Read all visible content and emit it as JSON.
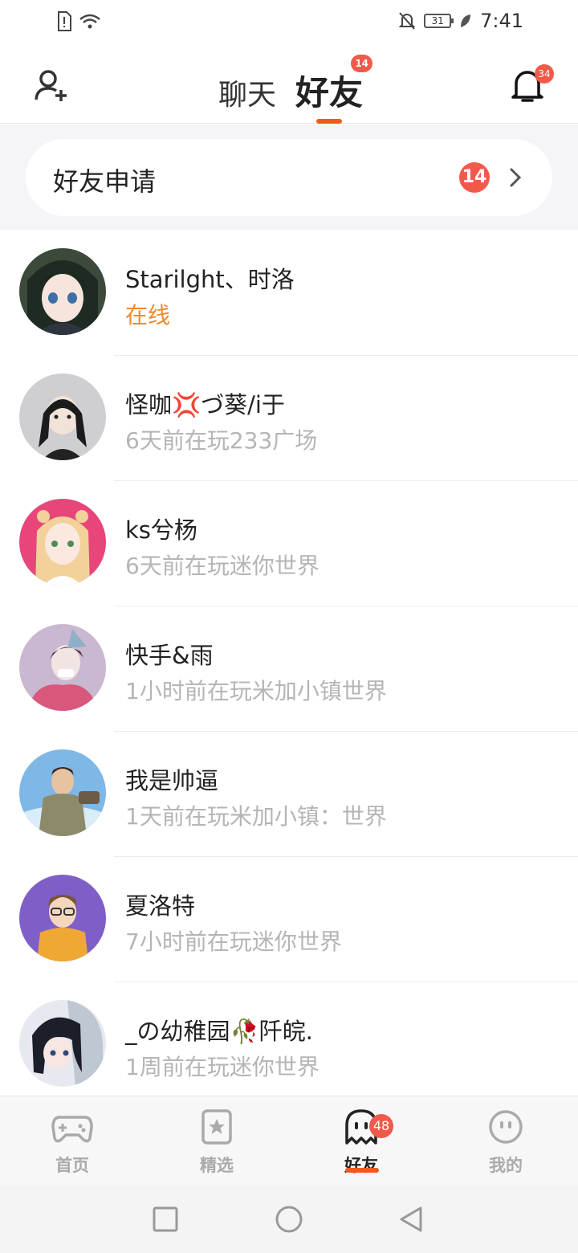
{
  "status_bar": {
    "time": "7:41",
    "battery": "31",
    "icons": [
      "sim-alert-icon",
      "wifi-icon",
      "mute-bell-icon",
      "battery-icon",
      "leaf-icon"
    ]
  },
  "header": {
    "tabs": [
      {
        "label": "聊天",
        "active": false
      },
      {
        "label": "好友",
        "active": true,
        "badge": "14"
      }
    ],
    "notification_badge": "34",
    "colors": {
      "accent": "#f15a1e",
      "badge": "#f15a4a",
      "online": "#f0892b"
    }
  },
  "friend_request": {
    "label": "好友申请",
    "badge": "14"
  },
  "friends": [
    {
      "name": "Starilght、时洛",
      "status": "在线"
    },
    {
      "name": "怪咖💢づ葵/i于",
      "status": "6天前在玩233广场"
    },
    {
      "name": "ks兮杨",
      "status": "6天前在玩迷你世界"
    },
    {
      "name": "快手&雨",
      "status": "1小时前在玩米加小镇世界"
    },
    {
      "name": "我是帅逼",
      "status": "1天前在玩米加小镇：世界"
    },
    {
      "name": "夏洛特",
      "status": "7小时前在玩迷你世界"
    },
    {
      "name": "_の幼稚园🥀阡皖.",
      "status": "1周前在玩迷你世界"
    }
  ],
  "bottom_nav": [
    {
      "label": "首页",
      "icon": "gamepad-icon",
      "active": false
    },
    {
      "label": "精选",
      "icon": "star-card-icon",
      "active": false
    },
    {
      "label": "好友",
      "icon": "ghost-icon",
      "active": true,
      "badge": "48"
    },
    {
      "label": "我的",
      "icon": "face-icon",
      "active": false
    }
  ]
}
